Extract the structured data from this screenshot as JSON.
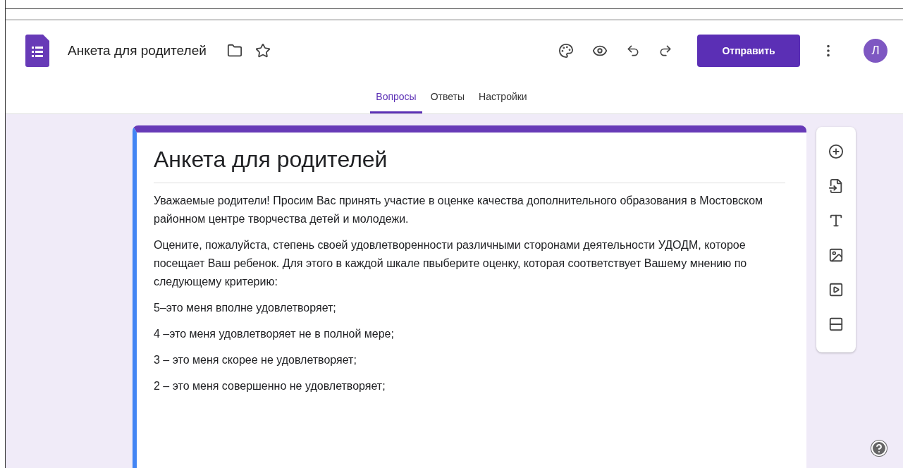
{
  "header": {
    "title": "Анкета для родителей",
    "send_button": "Отправить",
    "avatar": "Л"
  },
  "tabs": [
    {
      "label": "Вопросы",
      "selected": true
    },
    {
      "label": "Ответы",
      "selected": false
    },
    {
      "label": "Настройки",
      "selected": false
    }
  ],
  "form": {
    "title": "Анкета для родителей",
    "paragraphs": [
      "Уважаемые родители! Просим Вас принять участие в оценке качества дополнительного образования в Мостовском районном центре творчества детей и молодежи.",
      "Оцените, пожалуйста, степень своей удовлетворенности различными сторонами деятельности УДОДМ, которое посещает Ваш ребенок. Для этого в каждой шкале пвыберите оценку, которая соответствует Вашему мнению по следующему критерию:",
      "5–это меня вполне удовлетворяет;",
      "4 –это меня удовлетворяет не в полной мере;",
      "3 – это меня скорее не удовлетворяет;",
      "2 – это меня совершенно не удовлетворяет;"
    ]
  }
}
